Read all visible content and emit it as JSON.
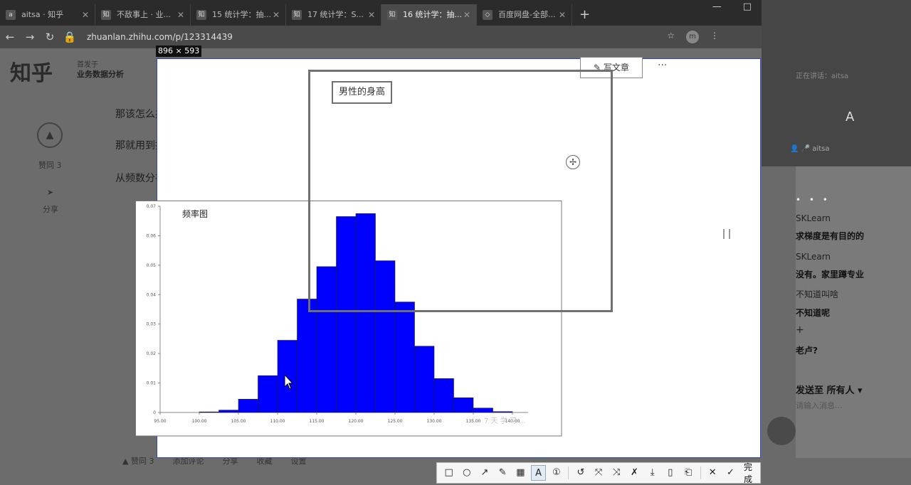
{
  "browser": {
    "tabs": [
      {
        "icon": "a",
        "title": "aitsa · 知乎"
      },
      {
        "icon": "知",
        "title": "不敌事上 · 业..."
      },
      {
        "icon": "知",
        "title": "15 统计学：抽..."
      },
      {
        "icon": "知",
        "title": "17 统计学：S..."
      },
      {
        "icon": "知",
        "title": "16 统计学：抽..."
      },
      {
        "icon": "◇",
        "title": "百度网盘-全部..."
      }
    ],
    "new_tab": "+",
    "url": "zhuanlan.zhihu.com/p/123314439",
    "profile_initial": "m"
  },
  "page": {
    "logo": "知乎",
    "column_small": "首发于",
    "column_name": "业务数据分析",
    "paragraphs": [
      "那该怎么办?",
      "那就用到接下来要讲的内容",
      "从频数分布到概率分布"
    ],
    "likes": "赞同 3",
    "share": "分享",
    "bottom_actions": [
      "▲ 赞同 3",
      "添加评论",
      "分享",
      "收藏",
      "设置"
    ]
  },
  "capture": {
    "size_label": "896 × 593",
    "write_article": "写文章",
    "more": "···",
    "annotation_label": "男性的身高",
    "watermark": "7 天 学 习 ..."
  },
  "chart_data": {
    "type": "bar",
    "title": "频率图",
    "xlabel": "",
    "ylabel": "",
    "x_ticks": [
      "95.00",
      "100.00",
      "105.00",
      "110.00",
      "115.00",
      "120.00",
      "125.00",
      "130.00",
      "135.00",
      "140.00"
    ],
    "y_ticks": [
      "0",
      "0.01",
      "0.02",
      "0.03",
      "0.04",
      "0.05",
      "0.06",
      "0.07"
    ],
    "xlim": [
      95,
      142
    ],
    "ylim": [
      0,
      0.07
    ],
    "bin_edges": [
      100,
      102.5,
      105,
      107.5,
      110,
      112.5,
      115,
      117.5,
      120,
      122.5,
      125,
      127.5,
      130,
      132.5,
      135,
      137.5,
      140
    ],
    "values": [
      0.0002,
      0.0008,
      0.0045,
      0.0125,
      0.0245,
      0.0385,
      0.0495,
      0.0665,
      0.0675,
      0.0515,
      0.0375,
      0.0225,
      0.0115,
      0.005,
      0.0015,
      0.0003
    ],
    "bar_color": "#0000ff"
  },
  "panel": {
    "speaking": "正在讲话：aitsa",
    "avatar_letter": "A",
    "mic_user": "aitsa",
    "dots": "• • •",
    "messages": [
      {
        "name": "SKLearn",
        "text": "求梯度是有目的的"
      },
      {
        "name": "SKLearn",
        "text": "没有。家里蹲专业"
      },
      {
        "name": "",
        "text": "不知道叫啥"
      },
      {
        "name": "",
        "text": "不知道呢"
      },
      {
        "name": "",
        "text": "+"
      },
      {
        "name": "",
        "text": "老卢?"
      }
    ],
    "send_to": "发送至 所有人 ▾",
    "input_placeholder": "请输入消息..."
  },
  "toolbar": {
    "icons": [
      "□",
      "○",
      "↗",
      "✎",
      "▦",
      "A",
      "①",
      "↺",
      "⤧",
      "⤨",
      "✗",
      "⤓",
      "▯",
      "⎗",
      "✕",
      "✓"
    ],
    "done": "完成"
  }
}
